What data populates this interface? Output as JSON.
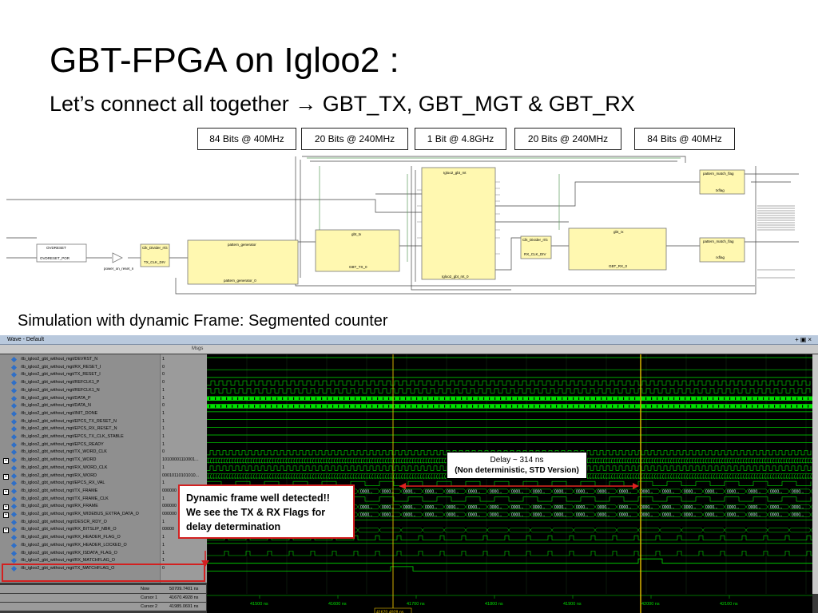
{
  "slide": {
    "title": "GBT-FPGA on Igloo2 :",
    "subtitle": "Let’s connect all together → GBT_TX, GBT_MGT & GBT_RX",
    "sim_caption": "Simulation with dynamic Frame: Segmented counter"
  },
  "bandwidth_labels": [
    "84 Bits @ 40MHz",
    "20 Bits @ 240MHz",
    "1 Bit @ 4.8GHz",
    "20 Bits @ 240MHz",
    "84 Bits @ 40MHz"
  ],
  "schematic": {
    "blocks": [
      "OVDRESET",
      "OVDRESET_POR",
      "power_on_reset_n",
      "Clk_Divider_r/G",
      "TX_CLK_DIV",
      "pattern_generator",
      "pattern_generator_0",
      "gbt_tx",
      "GBT_TX_0",
      "Igloo2_gbt_mt",
      "Igloo2_gbt_mt_0",
      "Clk_Divider_r/G",
      "RX_CLK_DIV",
      "gbt_rx",
      "GBT_RX_0",
      "pattern_match_flag",
      "txflag",
      "pattern_match_flag",
      "rxflag"
    ]
  },
  "wave": {
    "window_title": "Wave - Default",
    "msgs_header": "Msgs",
    "signals": [
      {
        "name": "/tb_igloo2_gbt_without_mgt/DEVRST_N",
        "value": "1",
        "expandable": false
      },
      {
        "name": "/tb_igloo2_gbt_without_mgt/RX_RESET_I",
        "value": "0",
        "expandable": false
      },
      {
        "name": "/tb_igloo2_gbt_without_mgt/TX_RESET_I",
        "value": "0",
        "expandable": false
      },
      {
        "name": "/tb_igloo2_gbt_without_mgt/REFCLK1_P",
        "value": "0",
        "expandable": false
      },
      {
        "name": "/tb_igloo2_gbt_without_mgt/REFCLK1_N",
        "value": "1",
        "expandable": false
      },
      {
        "name": "/tb_igloo2_gbt_without_mgt/DATA_P",
        "value": "1",
        "expandable": false
      },
      {
        "name": "/tb_igloo2_gbt_without_mgt/DATA_N",
        "value": "0",
        "expandable": false
      },
      {
        "name": "/tb_igloo2_gbt_without_mgt/INIT_DONE",
        "value": "1",
        "expandable": false
      },
      {
        "name": "/tb_igloo2_gbt_without_mgt/EPCS_TX_RESET_N",
        "value": "1",
        "expandable": false
      },
      {
        "name": "/tb_igloo2_gbt_without_mgt/EPCS_RX_RESET_N",
        "value": "1",
        "expandable": false
      },
      {
        "name": "/tb_igloo2_gbt_without_mgt/EPCS_TX_CLK_STABLE",
        "value": "1",
        "expandable": false
      },
      {
        "name": "/tb_igloo2_gbt_without_mgt/EPCS_READY",
        "value": "1",
        "expandable": false
      },
      {
        "name": "/tb_igloo2_gbt_without_mgt/TX_WORD_CLK",
        "value": "0",
        "expandable": false
      },
      {
        "name": "/tb_igloo2_gbt_without_mgt/TX_WORD",
        "value": "10100001110001...",
        "expandable": true
      },
      {
        "name": "/tb_igloo2_gbt_without_mgt/RX_WORD_CLK",
        "value": "1",
        "expandable": false
      },
      {
        "name": "/tb_igloo2_gbt_without_mgt/RX_WORD",
        "value": "00010110101010...",
        "expandable": true
      },
      {
        "name": "/tb_igloo2_gbt_without_mgt/EPCS_RX_VAL",
        "value": "1",
        "expandable": false
      },
      {
        "name": "/tb_igloo2_gbt_without_mgt/TX_FRAME",
        "value": "000000",
        "expandable": true
      },
      {
        "name": "/tb_igloo2_gbt_without_mgt/TX_FRAME_CLK",
        "value": "1",
        "expandable": false
      },
      {
        "name": "/tb_igloo2_gbt_without_mgt/RX_FRAME",
        "value": "000000",
        "expandable": true
      },
      {
        "name": "/tb_igloo2_gbt_without_mgt/RX_WIDEBUS_EXTRA_DATA_O",
        "value": "000000",
        "expandable": true
      },
      {
        "name": "/tb_igloo2_gbt_without_mgt/DESCR_RDY_O",
        "value": "1",
        "expandable": false
      },
      {
        "name": "/tb_igloo2_gbt_without_mgt/RX_BITSLIP_NBR_O",
        "value": "00000",
        "expandable": true
      },
      {
        "name": "/tb_igloo2_gbt_without_mgt/RX_HEADER_FLAG_O",
        "value": "1",
        "expandable": false
      },
      {
        "name": "/tb_igloo2_gbt_without_mgt/RX_HEADER_LOCKED_O",
        "value": "1",
        "expandable": false
      },
      {
        "name": "/tb_igloo2_gbt_without_mgt/RX_ISDATA_FLAG_O",
        "value": "1",
        "expandable": false
      },
      {
        "name": "/tb_igloo2_gbt_without_mgt/RX_MATCHFLAG_O",
        "value": "1",
        "expandable": false
      },
      {
        "name": "/tb_igloo2_gbt_without_mgt/TX_MATCHFLAG_O",
        "value": "0",
        "expandable": false
      }
    ],
    "timeline_ticks": [
      "41500 ns",
      "41600 ns",
      "41700 ns",
      "41800 ns",
      "41900 ns",
      "42000 ns",
      "42100 ns"
    ],
    "cursor_rows": [
      {
        "label": "Now",
        "value": "50709.7401 ns"
      },
      {
        "label": "Cursor 1",
        "value": "41670.4928 ns"
      },
      {
        "label": "Cursor 2",
        "value": "41985.0691 ns"
      }
    ],
    "cursor1_time": "41670.4928 ns",
    "cursor2_time": "41985.0691 ns",
    "cursor_delta": "314.5763 ns",
    "bus_value_text": "0000...",
    "clock_text": "((((("
  },
  "annotations": {
    "delay_line1": "Delay ~ 314 ns",
    "delay_line2": "(Non deterministic,  STD Version)",
    "callout_line1": "Dynamic frame well detected!!",
    "callout_line2": "We see the TX & RX Flags for",
    "callout_line3": "delay determination"
  },
  "colors": {
    "waveform": "#00e000",
    "cursor": "#e8c000",
    "callout_border": "#d32020",
    "block_fill": "#fff8b0"
  }
}
